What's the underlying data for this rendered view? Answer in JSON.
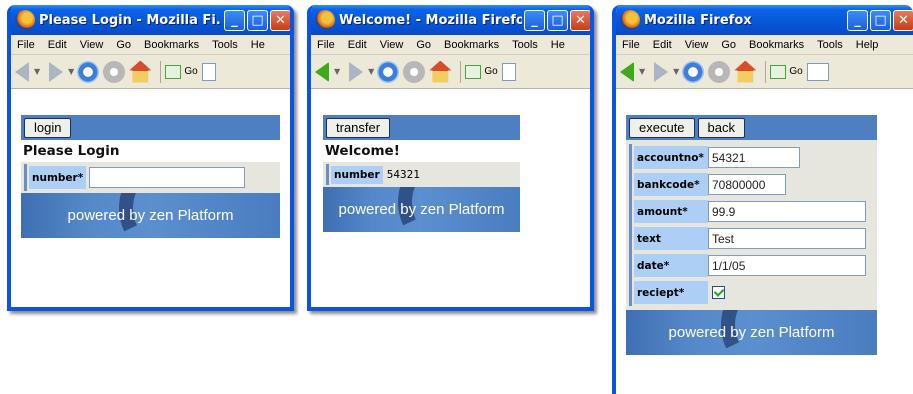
{
  "colors": {
    "titlebar": "#0b63e5",
    "toolbar_bar": "#4e7fc0",
    "label_bg": "#aecff5",
    "form_bg": "#e6e6df"
  },
  "menu": {
    "file": "File",
    "edit": "Edit",
    "view": "View",
    "go": "Go",
    "bookmarks": "Bookmarks",
    "tools": "Tools",
    "help_w1": "He",
    "help_w2": "He",
    "help_w3": "Help"
  },
  "toolbar": {
    "go_label": "Go"
  },
  "banner_text": "powered by zen Platform",
  "window1": {
    "title": "Please Login - Mozilla Fi...",
    "button": "login",
    "heading": "Please Login",
    "field_label": "number*",
    "field_value": ""
  },
  "window2": {
    "title": "Welcome! - Mozilla Firefox",
    "button": "transfer",
    "heading": "Welcome!",
    "field_label": "number",
    "field_value": "54321"
  },
  "window3": {
    "title": "Mozilla Firefox",
    "buttons": {
      "execute": "execute",
      "back": "back"
    },
    "fields": [
      {
        "label": "accountno*",
        "value": "54321"
      },
      {
        "label": "bankcode*",
        "value": "70800000"
      },
      {
        "label": "amount*",
        "value": "99.9"
      },
      {
        "label": "text",
        "value": "Test"
      },
      {
        "label": "date*",
        "value": "1/1/05"
      },
      {
        "label": "reciept*",
        "checked": true
      }
    ]
  }
}
